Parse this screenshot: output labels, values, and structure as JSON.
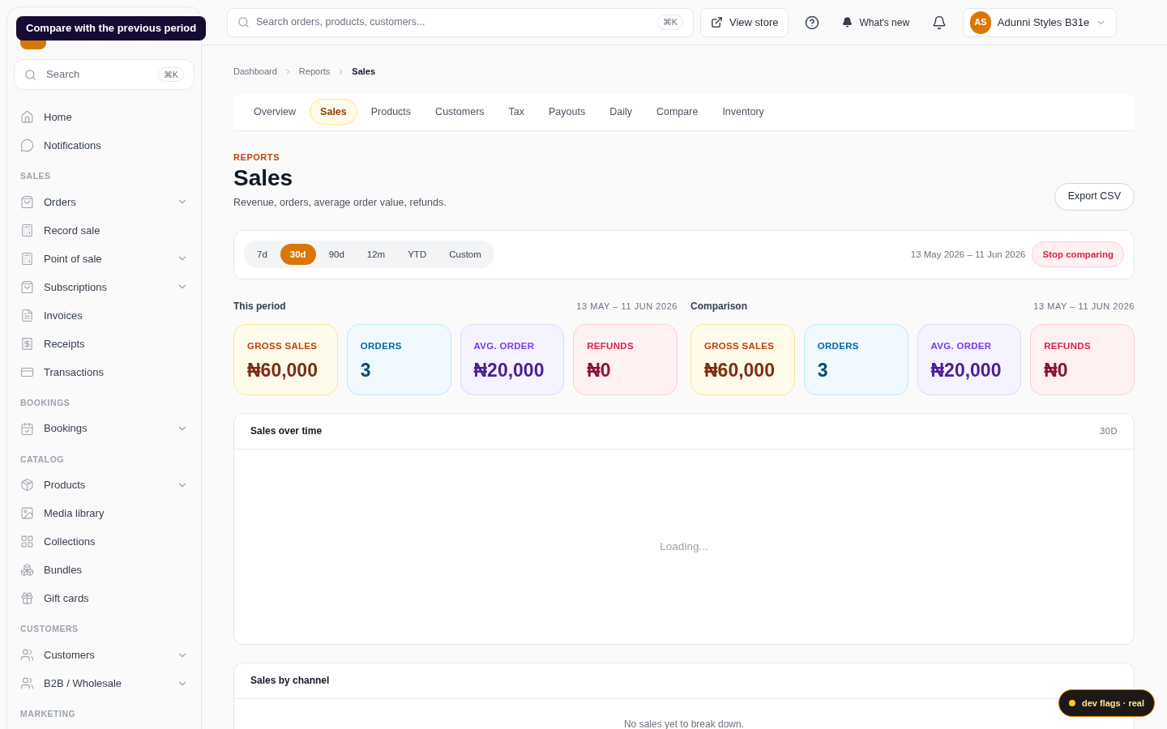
{
  "tooltip": "Compare with the previous period",
  "sidebar_search": {
    "placeholder": "Search",
    "shortcut": "⌘K"
  },
  "sidebar": [
    {
      "items": [
        {
          "label": "Home",
          "kind": "link"
        },
        {
          "label": "Notifications",
          "kind": "link"
        }
      ]
    },
    {
      "heading": "SALES",
      "items": [
        {
          "label": "Orders",
          "kind": "group"
        },
        {
          "label": "Record sale",
          "kind": "link"
        },
        {
          "label": "Point of sale",
          "kind": "group"
        },
        {
          "label": "Subscriptions",
          "kind": "group"
        },
        {
          "label": "Invoices",
          "kind": "link"
        },
        {
          "label": "Receipts",
          "kind": "link"
        },
        {
          "label": "Transactions",
          "kind": "link"
        }
      ]
    },
    {
      "heading": "BOOKINGS",
      "items": [
        {
          "label": "Bookings",
          "kind": "group"
        }
      ]
    },
    {
      "heading": "CATALOG",
      "items": [
        {
          "label": "Products",
          "kind": "group"
        },
        {
          "label": "Media library",
          "kind": "link"
        },
        {
          "label": "Collections",
          "kind": "link"
        },
        {
          "label": "Bundles",
          "kind": "link"
        },
        {
          "label": "Gift cards",
          "kind": "link"
        }
      ]
    },
    {
      "heading": "CUSTOMERS",
      "items": [
        {
          "label": "Customers",
          "kind": "group"
        },
        {
          "label": "B2B / Wholesale",
          "kind": "group"
        }
      ]
    },
    {
      "heading": "MARKETING"
    }
  ],
  "topbar": {
    "search_placeholder": "Search orders, products, customers...",
    "shortcut": "⌘K",
    "view_store": "View store",
    "whats_new": "What's new",
    "user": {
      "initials": "AS",
      "name": "Adunni Styles B31e"
    }
  },
  "breadcrumbs": [
    "Dashboard",
    "Reports",
    "Sales"
  ],
  "tabs": [
    {
      "label": "Overview",
      "selected": false
    },
    {
      "label": "Sales",
      "selected": true
    },
    {
      "label": "Products",
      "selected": false
    },
    {
      "label": "Customers",
      "selected": false
    },
    {
      "label": "Tax",
      "selected": false
    },
    {
      "label": "Payouts",
      "selected": false
    },
    {
      "label": "Daily",
      "selected": false
    },
    {
      "label": "Compare",
      "selected": false
    },
    {
      "label": "Inventory",
      "selected": false
    }
  ],
  "eyebrow": "REPORTS",
  "title": "Sales",
  "subtitle": "Revenue, orders, average order value, refunds.",
  "export_button": "Export CSV",
  "ranges": [
    {
      "label": "7d",
      "selected": false
    },
    {
      "label": "30d",
      "selected": true
    },
    {
      "label": "90d",
      "selected": false
    },
    {
      "label": "12m",
      "selected": false
    },
    {
      "label": "YTD",
      "selected": false
    },
    {
      "label": "Custom",
      "selected": false
    }
  ],
  "date_range": "13 May 2026 – 11 Jun 2026",
  "stop_button": "Stop comparing",
  "periods": [
    {
      "title": "This period",
      "range": "13 MAY – 11 JUN 2026",
      "metrics": [
        {
          "kind": "amber",
          "label": "GROSS SALES",
          "value": "₦60,000"
        },
        {
          "kind": "sky",
          "label": "ORDERS",
          "value": "3"
        },
        {
          "kind": "violet",
          "label": "AVG. ORDER",
          "value": "₦20,000"
        },
        {
          "kind": "rose",
          "label": "REFUNDS",
          "value": "₦0"
        }
      ]
    },
    {
      "title": "Comparison",
      "range": "13 MAY – 11 JUN 2026",
      "metrics": [
        {
          "kind": "amber",
          "label": "GROSS SALES",
          "value": "₦60,000"
        },
        {
          "kind": "sky",
          "label": "ORDERS",
          "value": "3"
        },
        {
          "kind": "violet",
          "label": "AVG. ORDER",
          "value": "₦20,000"
        },
        {
          "kind": "rose",
          "label": "REFUNDS",
          "value": "₦0"
        }
      ]
    }
  ],
  "panels": [
    {
      "title": "Sales over time",
      "tag": "30D",
      "message": "Loading...",
      "kind": "loading"
    },
    {
      "title": "Sales by channel",
      "message": "No sales yet to break down.",
      "kind": "empty"
    }
  ],
  "dev_badge": "dev flags · real"
}
